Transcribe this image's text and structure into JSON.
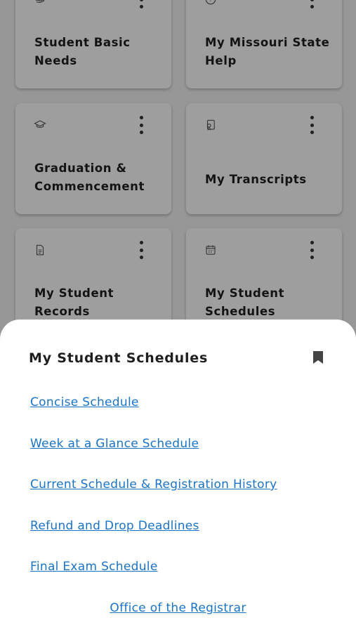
{
  "tiles": [
    {
      "title": "Student Basic Needs",
      "icon": "hand-icon"
    },
    {
      "title": "My Missouri State Help",
      "icon": "help-icon"
    },
    {
      "title": "Graduation & Commencement",
      "icon": "graduation-cap-icon"
    },
    {
      "title": "My Transcripts",
      "icon": "certificate-icon"
    },
    {
      "title": "My Student Records",
      "icon": "document-icon"
    },
    {
      "title": "My Student Schedules",
      "icon": "calendar-icon"
    }
  ],
  "sheet": {
    "title": "My Student Schedules",
    "links": [
      "Concise Schedule",
      "Week at a Glance Schedule",
      "Current Schedule & Registration History",
      "Refund and Drop Deadlines",
      "Final Exam Schedule"
    ],
    "footer_link": "Office of the Registrar"
  },
  "colors": {
    "link": "#1a73c8",
    "scrim": "rgba(0,0,0,0.38)"
  }
}
